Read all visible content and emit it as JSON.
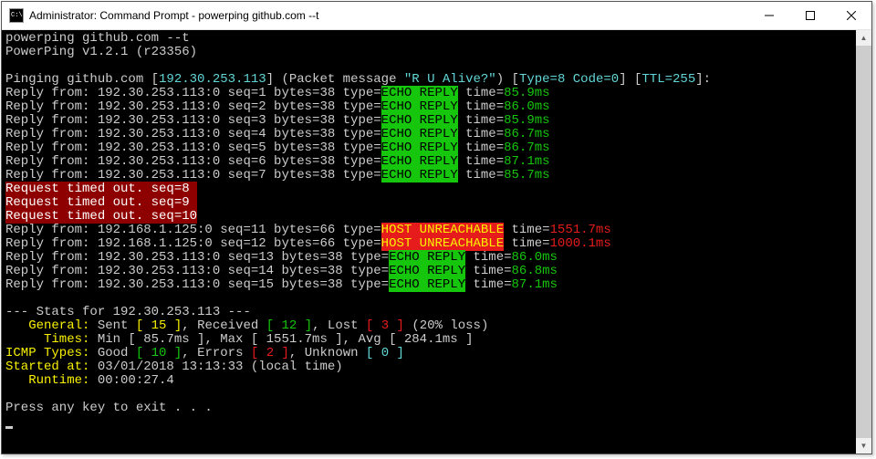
{
  "window_title": "Administrator: Command Prompt - powerping  github.com --t",
  "command_line": "powerping github.com --t",
  "version_line": "PowerPing v1.2.1 (r23356)",
  "ping_header": {
    "prefix": "Pinging github.com [",
    "ip": "192.30.253.113",
    "after_ip": "] (Packet message ",
    "msg": "\"R U Alive?\"",
    "after_msg": ") [",
    "type": "Type=8",
    "space1": " ",
    "code": "Code=0",
    "after_code": "] [",
    "ttl": "TTL=255",
    "suffix": "]:"
  },
  "replies_ok1": [
    {
      "prefix": "Reply from: 192.30.253.113:0 seq=1 bytes=38 type=",
      "type": "ECHO REPLY",
      "time_label": " time=",
      "time": "85.9ms"
    },
    {
      "prefix": "Reply from: 192.30.253.113:0 seq=2 bytes=38 type=",
      "type": "ECHO REPLY",
      "time_label": " time=",
      "time": "86.0ms"
    },
    {
      "prefix": "Reply from: 192.30.253.113:0 seq=3 bytes=38 type=",
      "type": "ECHO REPLY",
      "time_label": " time=",
      "time": "85.9ms"
    },
    {
      "prefix": "Reply from: 192.30.253.113:0 seq=4 bytes=38 type=",
      "type": "ECHO REPLY",
      "time_label": " time=",
      "time": "86.7ms"
    },
    {
      "prefix": "Reply from: 192.30.253.113:0 seq=5 bytes=38 type=",
      "type": "ECHO REPLY",
      "time_label": " time=",
      "time": "86.7ms"
    },
    {
      "prefix": "Reply from: 192.30.253.113:0 seq=6 bytes=38 type=",
      "type": "ECHO REPLY",
      "time_label": " time=",
      "time": "87.1ms"
    },
    {
      "prefix": "Reply from: 192.30.253.113:0 seq=7 bytes=38 type=",
      "type": "ECHO REPLY",
      "time_label": " time=",
      "time": "85.7ms"
    }
  ],
  "timeouts": [
    "Request timed out. seq=8 ",
    "Request timed out. seq=9 ",
    "Request timed out. seq=10"
  ],
  "replies_err": [
    {
      "prefix": "Reply from: 192.168.1.125:0 seq=11 bytes=66 type=",
      "type": "HOST UNREACHABLE",
      "time_label": " time=",
      "time": "1551.7ms"
    },
    {
      "prefix": "Reply from: 192.168.1.125:0 seq=12 bytes=66 type=",
      "type": "HOST UNREACHABLE",
      "time_label": " time=",
      "time": "1000.1ms"
    }
  ],
  "replies_ok2": [
    {
      "prefix": "Reply from: 192.30.253.113:0 seq=13 bytes=38 type=",
      "type": "ECHO REPLY",
      "time_label": " time=",
      "time": "86.0ms"
    },
    {
      "prefix": "Reply from: 192.30.253.113:0 seq=14 bytes=38 type=",
      "type": "ECHO REPLY",
      "time_label": " time=",
      "time": "86.8ms"
    },
    {
      "prefix": "Reply from: 192.30.253.113:0 seq=15 bytes=38 type=",
      "type": "ECHO REPLY",
      "time_label": " time=",
      "time": "87.1ms"
    }
  ],
  "stats": {
    "header_prefix": "--- Stats for ",
    "header_ip": "192.30.253.113",
    "header_suffix": " ---",
    "general": {
      "label": "   General:",
      "sent_lbl": " Sent ",
      "sent_val": "[ 15 ]",
      "recv_lbl": ", Received ",
      "recv_val": "[ 12 ]",
      "lost_lbl": ", Lost ",
      "lost_val": "[ 3 ]",
      "loss": " (20% loss)"
    },
    "times": {
      "label": "     Times:",
      "body": " Min [ 85.7ms ], Max [ 1551.7ms ], Avg [ 284.1ms ]"
    },
    "icmp": {
      "label": "ICMP Types:",
      "good_lbl": " Good ",
      "good_val": "[ 10 ]",
      "err_lbl": ", Errors ",
      "err_val": "[ 2 ]",
      "unk_lbl": ", Unknown ",
      "unk_val": "[ 0 ]"
    },
    "started": {
      "label": "Started at:",
      "body": " 03/01/2018 13:13:33 (local time)"
    },
    "runtime": {
      "label": "   Runtime:",
      "body": " 00:00:27.4"
    }
  },
  "exit_prompt": "Press any key to exit . . ."
}
